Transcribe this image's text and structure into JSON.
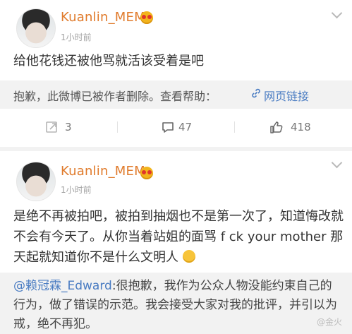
{
  "post1": {
    "username": "Kuanlin_MEM",
    "time": "1小时前",
    "text": "给他花钱还被他骂就活该受着是吧",
    "notice_text": "抱歉，此微博已被作者删除。查看帮助：",
    "notice_link": "网页链接",
    "toolbar": {
      "repost_count": "3",
      "comment_count": "47",
      "like_count": "418"
    }
  },
  "post2": {
    "username": "Kuanlin_MEM",
    "time": "1小时前",
    "text": "是绝不再被拍吧，被拍到抽烟也不是第一次了，知道悔改就不会有今天了。从你当着站姐的面骂 f ck your mother 那天起就知道你不是什么文明人",
    "quote_mention": "@赖冠霖_Edward",
    "quote_text": ":很抱歉，我作为公众人物没能约束自己的行为，做了错误的示范。我会接受大家对我的批评，并引以为戒，绝不再犯。"
  },
  "watermark": "@金火"
}
